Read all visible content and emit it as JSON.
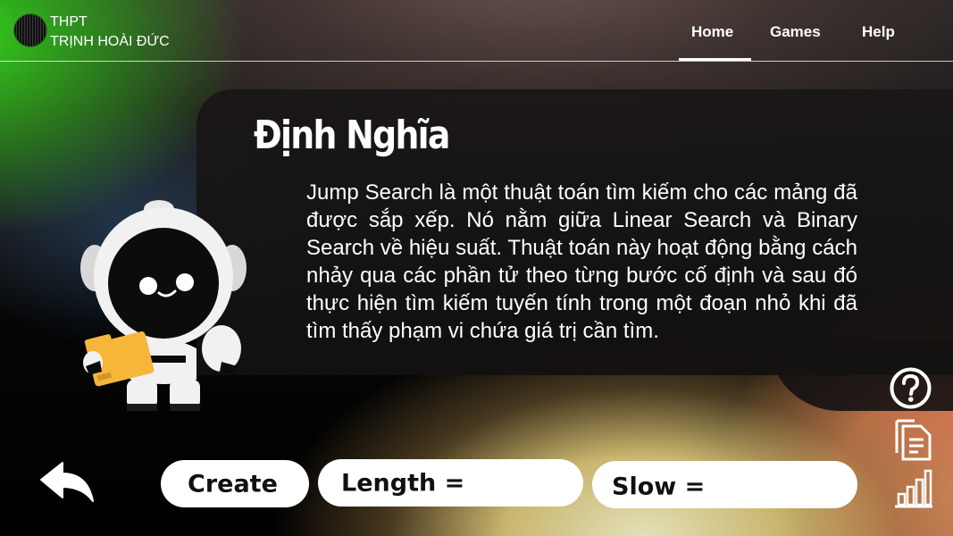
{
  "header": {
    "school_line1": "THPT",
    "school_line2": "TRỊNH HOÀI ĐỨC",
    "nav": [
      {
        "label": "Home"
      },
      {
        "label": "Games"
      },
      {
        "label": "Help"
      }
    ]
  },
  "content": {
    "title": "Định Nghĩa",
    "body": "Jump Search là một thuật toán tìm kiếm cho các mảng đã được sắp xếp. Nó nằm giữa Linear Search và Binary Search về hiệu suất. Thuật toán này hoạt động bằng cách nhảy qua các phần tử theo từng bước cố định và sau đó thực hiện tìm kiếm tuyến tính trong một đoạn nhỏ khi đã tìm thấy phạm vi chứa giá trị cần tìm."
  },
  "controls": {
    "create_label": "Create",
    "length_label": "Length =",
    "length_value": "",
    "slow_label": "Slow =",
    "slow_value": ""
  },
  "icons": {
    "back": "back-arrow-icon",
    "help": "question-circle-icon",
    "document": "document-icon",
    "chart": "bar-chart-icon"
  },
  "colors": {
    "accent_green": "#33d11a",
    "robot_folder": "#f5b63a"
  }
}
